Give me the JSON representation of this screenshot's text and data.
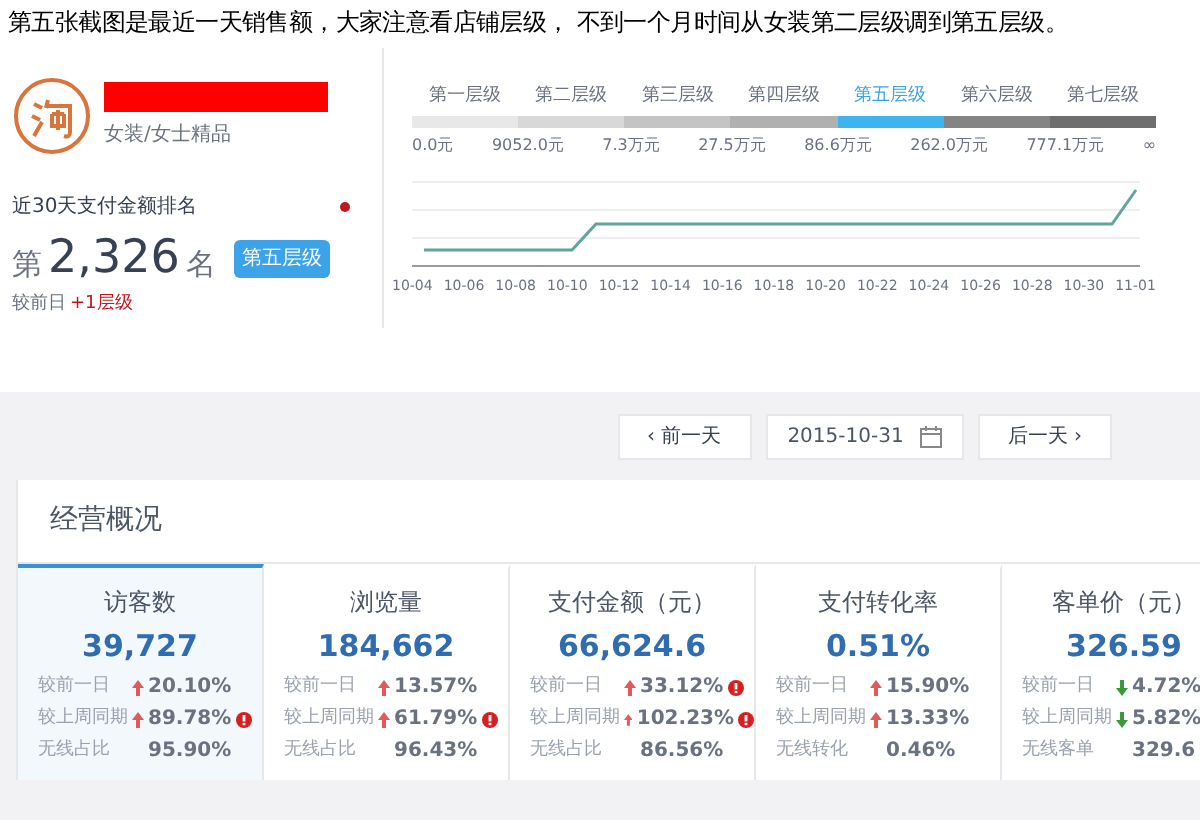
{
  "caption": "第五张截图是最近一天销售额，大家注意看店铺层级， 不到一个月时间从女装第二层级调到第五层级。",
  "shop": {
    "category": "女装/女士精品",
    "rank_label": "近30天支付金额排名",
    "rank_prefix": "第",
    "rank": "2,326",
    "rank_suffix": "名",
    "tier_badge": "第五层级",
    "compare_label": "较前日",
    "compare_value": "+1层级"
  },
  "tiers": [
    {
      "label": "第一层级",
      "selected": false
    },
    {
      "label": "第二层级",
      "selected": false
    },
    {
      "label": "第三层级",
      "selected": false
    },
    {
      "label": "第四层级",
      "selected": false
    },
    {
      "label": "第五层级",
      "selected": true
    },
    {
      "label": "第六层级",
      "selected": false
    },
    {
      "label": "第七层级",
      "selected": false
    }
  ],
  "thresholds": [
    "0.0元",
    "9052.0元",
    "7.3万元",
    "27.5万元",
    "86.6万元",
    "262.0万元",
    "777.1万元",
    "∞"
  ],
  "chart_x_labels": [
    "10-04",
    "10-06",
    "10-08",
    "10-10",
    "10-12",
    "10-14",
    "10-16",
    "10-18",
    "10-20",
    "10-22",
    "10-24",
    "10-26",
    "10-28",
    "10-30",
    "11-01"
  ],
  "date_nav": {
    "prev": "‹ 前一天",
    "date": "2015-10-31",
    "next": "后一天 ›"
  },
  "overview": {
    "title": "经营概况",
    "metrics": [
      {
        "title": "访客数",
        "value": "39,727",
        "selected": true,
        "rows": [
          {
            "label": "较前一日",
            "kind": "up",
            "value": "20.10%",
            "alert": false
          },
          {
            "label": "较上周同期",
            "kind": "up",
            "value": "89.78%",
            "alert": true
          },
          {
            "label": "无线占比",
            "kind": "none",
            "value": "95.90%",
            "alert": false
          }
        ]
      },
      {
        "title": "浏览量",
        "value": "184,662",
        "selected": false,
        "rows": [
          {
            "label": "较前一日",
            "kind": "up",
            "value": "13.57%",
            "alert": false
          },
          {
            "label": "较上周同期",
            "kind": "up",
            "value": "61.79%",
            "alert": true
          },
          {
            "label": "无线占比",
            "kind": "none",
            "value": "96.43%",
            "alert": false
          }
        ]
      },
      {
        "title": "支付金额（元）",
        "value": "66,624.6",
        "selected": false,
        "rows": [
          {
            "label": "较前一日",
            "kind": "up",
            "value": "33.12%",
            "alert": true
          },
          {
            "label": "较上周同期",
            "kind": "up",
            "value": "102.23%",
            "alert": true
          },
          {
            "label": "无线占比",
            "kind": "none",
            "value": "86.56%",
            "alert": false
          }
        ]
      },
      {
        "title": "支付转化率",
        "value": "0.51%",
        "selected": false,
        "rows": [
          {
            "label": "较前一日",
            "kind": "up",
            "value": "15.90%",
            "alert": false
          },
          {
            "label": "较上周同期",
            "kind": "up",
            "value": "13.33%",
            "alert": false
          },
          {
            "label": "无线转化",
            "kind": "none",
            "value": "0.46%",
            "alert": false
          }
        ]
      },
      {
        "title": "客单价（元）",
        "value": "326.59",
        "selected": false,
        "rows": [
          {
            "label": "较前一日",
            "kind": "down",
            "value": "4.72%",
            "alert": false
          },
          {
            "label": "较上周同期",
            "kind": "down",
            "value": "5.82%",
            "alert": false
          },
          {
            "label": "无线客单",
            "kind": "none",
            "value": "329.6",
            "alert": false
          }
        ]
      }
    ]
  }
}
